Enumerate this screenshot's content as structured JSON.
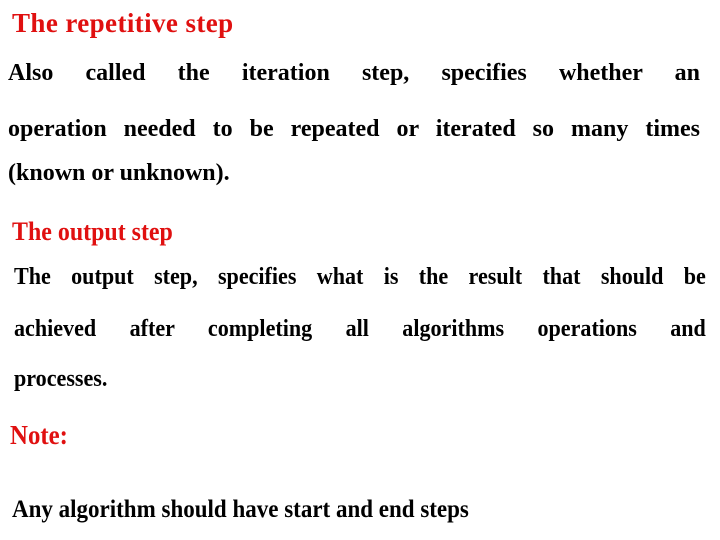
{
  "colors": {
    "heading": "#e01010",
    "body": "#000000",
    "background": "#ffffff"
  },
  "sections": [
    {
      "heading": "The repetitive step",
      "lines": [
        "Also called the iteration step, specifies whether an",
        "operation needed to be repeated or iterated so many times",
        "(known or unknown)."
      ]
    },
    {
      "heading": "The output step",
      "lines": [
        "The output step, specifies what is the result that should be",
        "achieved after completing all algorithms operations and",
        "processes."
      ]
    },
    {
      "heading": "Note:",
      "lines": [
        "Any algorithm should have start and end steps"
      ]
    }
  ]
}
